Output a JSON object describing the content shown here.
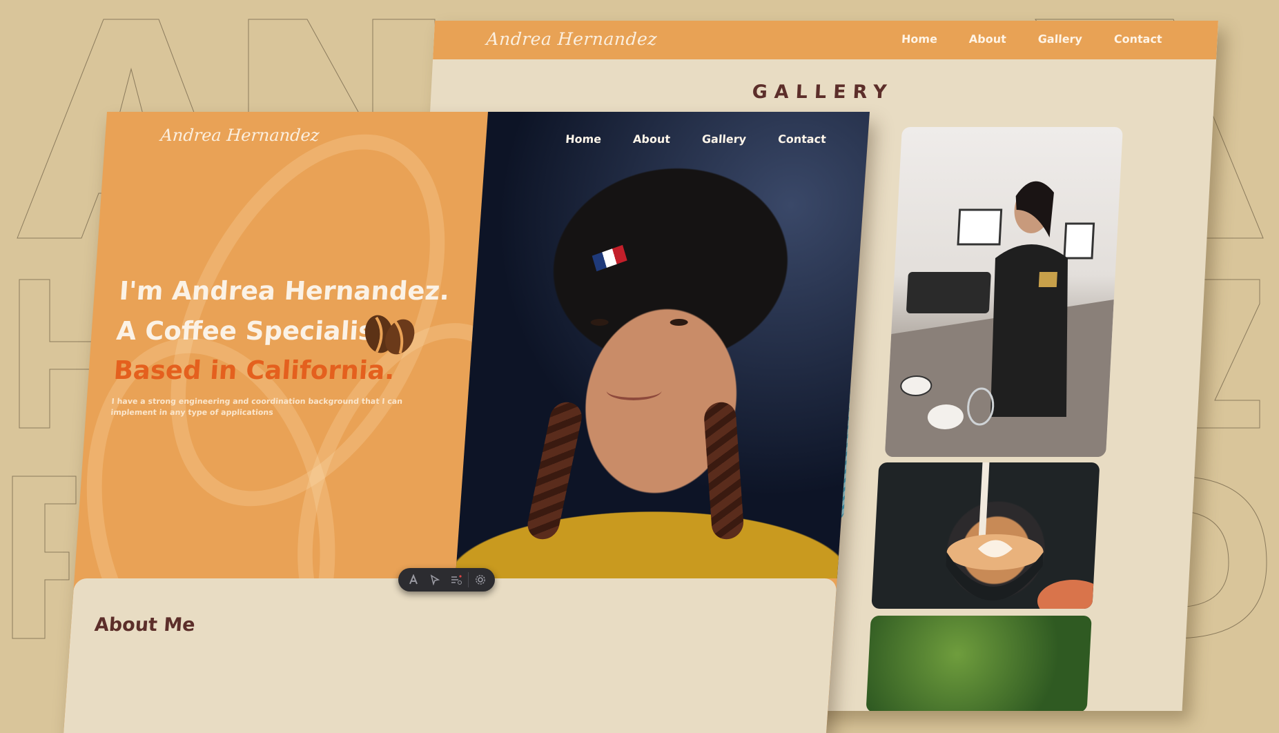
{
  "back_page": {
    "logo": "Andrea Hernandez",
    "nav": [
      "Home",
      "About",
      "Gallery",
      "Contact"
    ],
    "section_title": "GALLERY"
  },
  "front_page": {
    "logo": "Andrea Hernandez",
    "nav": [
      "Home",
      "About",
      "Gallery",
      "Contact"
    ],
    "headline_line1": "I'm Andrea Hernandez.",
    "headline_line2": "A Coffee Specialist",
    "headline_line3": "Based in California.",
    "description": "I have a strong engineering and coordination background that I can implement in any type of applications",
    "about_title": "About Me"
  },
  "toolbar": {
    "tools": [
      "text-tool-icon",
      "cursor-tool-icon",
      "list-tool-icon",
      "settings-icon"
    ]
  },
  "colors": {
    "background": "#d9c59a",
    "accent_orange": "#e8a255",
    "highlight_orange": "#e4601e",
    "cream": "#e8dcc3",
    "brown_text": "#5c2e2a"
  }
}
